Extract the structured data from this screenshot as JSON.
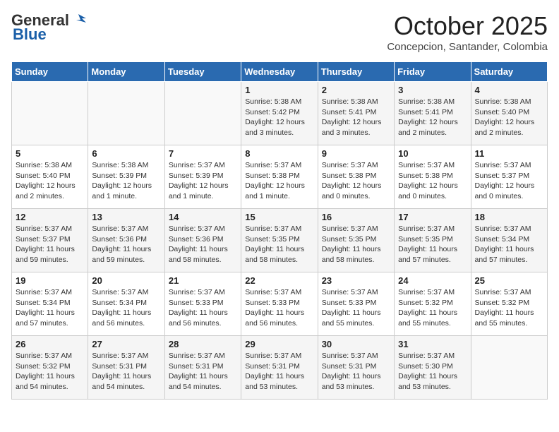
{
  "header": {
    "logo_general": "General",
    "logo_blue": "Blue",
    "month": "October 2025",
    "location": "Concepcion, Santander, Colombia"
  },
  "weekdays": [
    "Sunday",
    "Monday",
    "Tuesday",
    "Wednesday",
    "Thursday",
    "Friday",
    "Saturday"
  ],
  "weeks": [
    [
      {
        "day": "",
        "info": ""
      },
      {
        "day": "",
        "info": ""
      },
      {
        "day": "",
        "info": ""
      },
      {
        "day": "1",
        "info": "Sunrise: 5:38 AM\nSunset: 5:42 PM\nDaylight: 12 hours\nand 3 minutes."
      },
      {
        "day": "2",
        "info": "Sunrise: 5:38 AM\nSunset: 5:41 PM\nDaylight: 12 hours\nand 3 minutes."
      },
      {
        "day": "3",
        "info": "Sunrise: 5:38 AM\nSunset: 5:41 PM\nDaylight: 12 hours\nand 2 minutes."
      },
      {
        "day": "4",
        "info": "Sunrise: 5:38 AM\nSunset: 5:40 PM\nDaylight: 12 hours\nand 2 minutes."
      }
    ],
    [
      {
        "day": "5",
        "info": "Sunrise: 5:38 AM\nSunset: 5:40 PM\nDaylight: 12 hours\nand 2 minutes."
      },
      {
        "day": "6",
        "info": "Sunrise: 5:38 AM\nSunset: 5:39 PM\nDaylight: 12 hours\nand 1 minute."
      },
      {
        "day": "7",
        "info": "Sunrise: 5:37 AM\nSunset: 5:39 PM\nDaylight: 12 hours\nand 1 minute."
      },
      {
        "day": "8",
        "info": "Sunrise: 5:37 AM\nSunset: 5:38 PM\nDaylight: 12 hours\nand 1 minute."
      },
      {
        "day": "9",
        "info": "Sunrise: 5:37 AM\nSunset: 5:38 PM\nDaylight: 12 hours\nand 0 minutes."
      },
      {
        "day": "10",
        "info": "Sunrise: 5:37 AM\nSunset: 5:38 PM\nDaylight: 12 hours\nand 0 minutes."
      },
      {
        "day": "11",
        "info": "Sunrise: 5:37 AM\nSunset: 5:37 PM\nDaylight: 12 hours\nand 0 minutes."
      }
    ],
    [
      {
        "day": "12",
        "info": "Sunrise: 5:37 AM\nSunset: 5:37 PM\nDaylight: 11 hours\nand 59 minutes."
      },
      {
        "day": "13",
        "info": "Sunrise: 5:37 AM\nSunset: 5:36 PM\nDaylight: 11 hours\nand 59 minutes."
      },
      {
        "day": "14",
        "info": "Sunrise: 5:37 AM\nSunset: 5:36 PM\nDaylight: 11 hours\nand 58 minutes."
      },
      {
        "day": "15",
        "info": "Sunrise: 5:37 AM\nSunset: 5:35 PM\nDaylight: 11 hours\nand 58 minutes."
      },
      {
        "day": "16",
        "info": "Sunrise: 5:37 AM\nSunset: 5:35 PM\nDaylight: 11 hours\nand 58 minutes."
      },
      {
        "day": "17",
        "info": "Sunrise: 5:37 AM\nSunset: 5:35 PM\nDaylight: 11 hours\nand 57 minutes."
      },
      {
        "day": "18",
        "info": "Sunrise: 5:37 AM\nSunset: 5:34 PM\nDaylight: 11 hours\nand 57 minutes."
      }
    ],
    [
      {
        "day": "19",
        "info": "Sunrise: 5:37 AM\nSunset: 5:34 PM\nDaylight: 11 hours\nand 57 minutes."
      },
      {
        "day": "20",
        "info": "Sunrise: 5:37 AM\nSunset: 5:34 PM\nDaylight: 11 hours\nand 56 minutes."
      },
      {
        "day": "21",
        "info": "Sunrise: 5:37 AM\nSunset: 5:33 PM\nDaylight: 11 hours\nand 56 minutes."
      },
      {
        "day": "22",
        "info": "Sunrise: 5:37 AM\nSunset: 5:33 PM\nDaylight: 11 hours\nand 56 minutes."
      },
      {
        "day": "23",
        "info": "Sunrise: 5:37 AM\nSunset: 5:33 PM\nDaylight: 11 hours\nand 55 minutes."
      },
      {
        "day": "24",
        "info": "Sunrise: 5:37 AM\nSunset: 5:32 PM\nDaylight: 11 hours\nand 55 minutes."
      },
      {
        "day": "25",
        "info": "Sunrise: 5:37 AM\nSunset: 5:32 PM\nDaylight: 11 hours\nand 55 minutes."
      }
    ],
    [
      {
        "day": "26",
        "info": "Sunrise: 5:37 AM\nSunset: 5:32 PM\nDaylight: 11 hours\nand 54 minutes."
      },
      {
        "day": "27",
        "info": "Sunrise: 5:37 AM\nSunset: 5:31 PM\nDaylight: 11 hours\nand 54 minutes."
      },
      {
        "day": "28",
        "info": "Sunrise: 5:37 AM\nSunset: 5:31 PM\nDaylight: 11 hours\nand 54 minutes."
      },
      {
        "day": "29",
        "info": "Sunrise: 5:37 AM\nSunset: 5:31 PM\nDaylight: 11 hours\nand 53 minutes."
      },
      {
        "day": "30",
        "info": "Sunrise: 5:37 AM\nSunset: 5:31 PM\nDaylight: 11 hours\nand 53 minutes."
      },
      {
        "day": "31",
        "info": "Sunrise: 5:37 AM\nSunset: 5:30 PM\nDaylight: 11 hours\nand 53 minutes."
      },
      {
        "day": "",
        "info": ""
      }
    ]
  ]
}
